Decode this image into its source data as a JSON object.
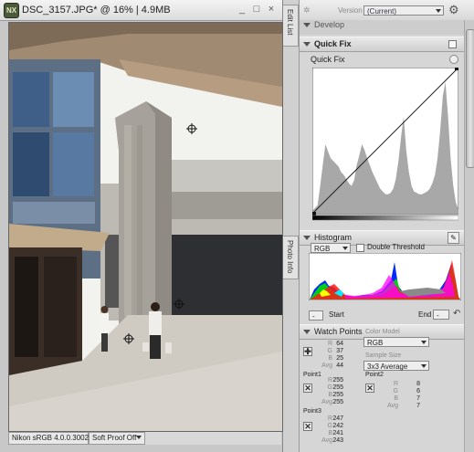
{
  "window": {
    "title": "DSC_3157.JPG* @ 16% | 4.9MB",
    "app_icon": "nx-logo-icon",
    "controls": [
      "_",
      "□",
      "×"
    ]
  },
  "status_bar": {
    "color_profile": "Nikon sRGB 4.0.0.3002",
    "soft_proof": "Soft Proof Off"
  },
  "side_tabs": [
    "Edit List",
    "Photo Info"
  ],
  "panel": {
    "version_label": "Version",
    "version_value": "(Current)",
    "develop_label": "Develop",
    "quick_fix_section": "Quick Fix",
    "quick_fix_label": "Quick Fix",
    "histogram_section": "Histogram",
    "channel_value": "RGB",
    "double_threshold": "Double Threshold",
    "start_label": "Start",
    "end_label": "End",
    "start_value": "-",
    "end_value": "-",
    "watch_points_section": "Watch Points",
    "color_model_label": "Color Model",
    "color_model_value": "RGB",
    "sample_size_label": "Sample Size",
    "sample_size_value": "3x3 Average",
    "keys": [
      "R",
      "G",
      "B",
      "Avg"
    ],
    "points": [
      {
        "name": "",
        "values": [
          "64",
          "37",
          "25",
          "44"
        ]
      },
      {
        "name": "Point1",
        "values": [
          "255",
          "255",
          "255",
          "255"
        ]
      },
      {
        "name": "Point2",
        "values": [
          "8",
          "6",
          "7",
          "7"
        ]
      },
      {
        "name": "Point3",
        "values": [
          "247",
          "242",
          "241",
          "243"
        ]
      }
    ]
  },
  "colors": {
    "panel_bg": "#d6d6d6",
    "histogram_fill": "#a8a8a8",
    "sky": "#f2f2ee",
    "facade": "#9b9892"
  }
}
